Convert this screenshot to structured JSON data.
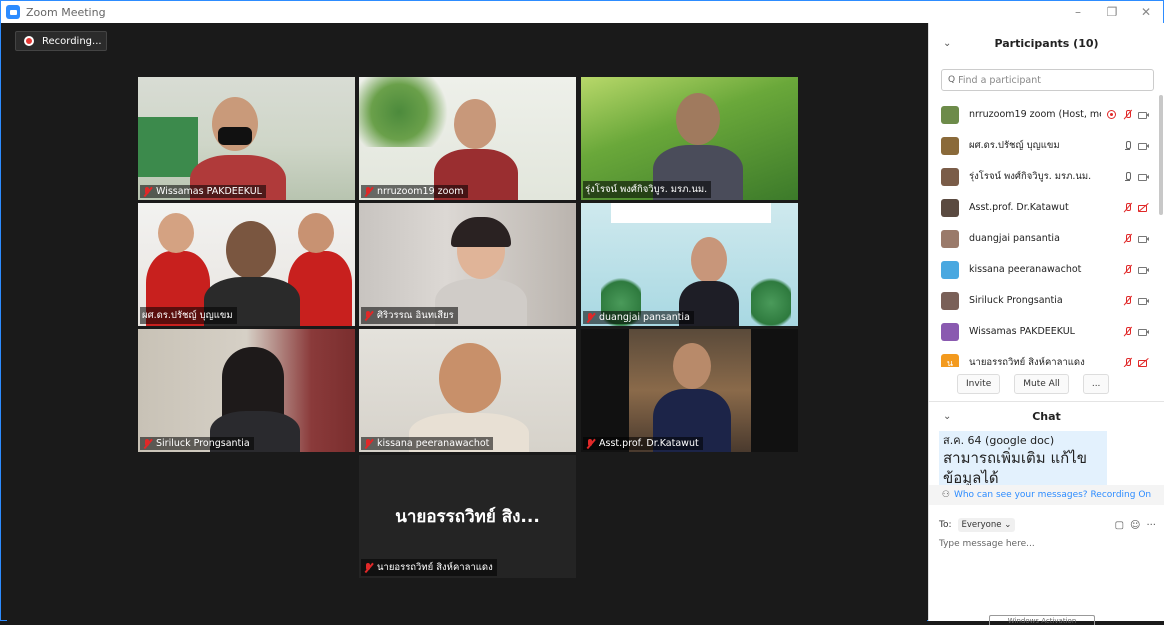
{
  "window": {
    "title": "Zoom Meeting",
    "minimize": "–",
    "maximize": "❐",
    "close": "✕"
  },
  "recording": {
    "label": "Recording..."
  },
  "tiles": [
    {
      "name": "Wissamas PAKDEEKUL",
      "muted": true,
      "active": false
    },
    {
      "name": "nrruzoom19 zoom",
      "muted": true,
      "active": false
    },
    {
      "name": "รุ่งโรจน์ พงศ์กิจวิบูร. มรภ.นม.",
      "muted": false,
      "active": false
    },
    {
      "name": "ผศ.ดร.ปรัชญ์ บุญแขม",
      "muted": false,
      "active": true
    },
    {
      "name": "ศิริวรรณ อินทเสียร",
      "muted": true,
      "active": false
    },
    {
      "name": "duangjai pansantia",
      "muted": true,
      "active": false
    },
    {
      "name": "Siriluck Prongsantia",
      "muted": true,
      "active": false
    },
    {
      "name": "kissana peeranawachot",
      "muted": true,
      "active": false
    },
    {
      "name": "Asst.prof. Dr.Katawut",
      "muted": true,
      "active": false
    },
    {
      "name": "นายอรรถวิทย์ สิงห์คาลาแดง",
      "muted": true,
      "active": false,
      "big_name": "นายอรรถวิทย์ สิง..."
    }
  ],
  "participants": {
    "title": "Participants (10)",
    "collapse": "⌄",
    "search_placeholder": "Find a participant",
    "items": [
      {
        "name": "nrruzoom19 zoom (Host, me)",
        "avatar_color": "#6d8b4a",
        "recording": true,
        "mic": "off",
        "cam": "on"
      },
      {
        "name": "ผศ.ดร.ปรัชญ์ บุญแขม",
        "avatar_color": "#8a6a3a",
        "recording": false,
        "mic": "on",
        "cam": "on"
      },
      {
        "name": "รุ่งโรจน์ พงศ์กิจวิบูร. มรภ.นม.",
        "avatar_color": "#7a5c48",
        "recording": false,
        "mic": "on",
        "cam": "on"
      },
      {
        "name": "Asst.prof. Dr.Katawut",
        "avatar_color": "#5a4a40",
        "recording": false,
        "mic": "off",
        "cam": "off"
      },
      {
        "name": "duangjai pansantia",
        "avatar_color": "#9a7a6a",
        "recording": false,
        "mic": "off",
        "cam": "on"
      },
      {
        "name": "kissana peeranawachot",
        "avatar_color": "#4aa8e0",
        "recording": false,
        "mic": "off",
        "cam": "on"
      },
      {
        "name": "Siriluck Prongsantia",
        "avatar_color": "#7a6058",
        "recording": false,
        "mic": "off",
        "cam": "on"
      },
      {
        "name": "Wissamas PAKDEEKUL",
        "avatar_color": "#8a5ab0",
        "recording": false,
        "mic": "off",
        "cam": "on"
      },
      {
        "name": "นายอรรถวิทย์ สิงห์คาลาแดง",
        "avatar_color": "#f39a1e",
        "avatar_text": "น",
        "recording": false,
        "mic": "off",
        "cam": "off"
      },
      {
        "name": "ศิริวรรณ อินทเสียร",
        "avatar_color": "#e07a30",
        "recording": false,
        "mic": "off",
        "cam": "on"
      }
    ],
    "buttons": {
      "invite": "Invite",
      "mute_all": "Mute All",
      "more": "..."
    }
  },
  "chat": {
    "title": "Chat",
    "collapse": "⌄",
    "message_line1": "ส.ค. 64 (google doc)",
    "message_line2": "สามารถเพิ่มเติม แก้ไข",
    "message_line3": "ข้อมูลได้",
    "who_can_see": "Who can see your messages? Recording On",
    "to_label": "To:",
    "to_value": "Everyone ⌄",
    "placeholder": "Type message here...",
    "icons": {
      "file": "▢",
      "emoji": "☺",
      "more": "···"
    },
    "watermark": "Windows Activation"
  }
}
